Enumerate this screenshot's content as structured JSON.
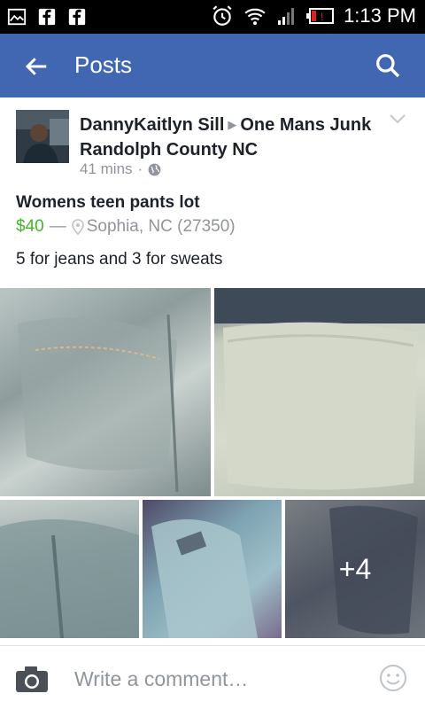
{
  "status_bar": {
    "time": "1:13 PM",
    "icons": [
      "image-icon",
      "facebook-icon",
      "facebook-icon",
      "alarm-icon",
      "wifi-icon",
      "signal-icon",
      "battery-alert-icon"
    ]
  },
  "app_bar": {
    "title": "Posts",
    "color": "#4267b2"
  },
  "post": {
    "author": "DannyKaitlyn Sill",
    "group": "One Mans Junk Randolph County NC",
    "time": "41 mins",
    "privacy_icon": "globe-icon",
    "listing": {
      "title": "Womens teen pants lot",
      "price": "$40",
      "separator": "—",
      "location": "Sophia, NC (27350)",
      "price_color": "#42b72a"
    },
    "description": "5 for jeans and 3 for sweats",
    "photos": {
      "more_count": "+4"
    }
  },
  "comment": {
    "placeholder": "Write a comment…"
  }
}
